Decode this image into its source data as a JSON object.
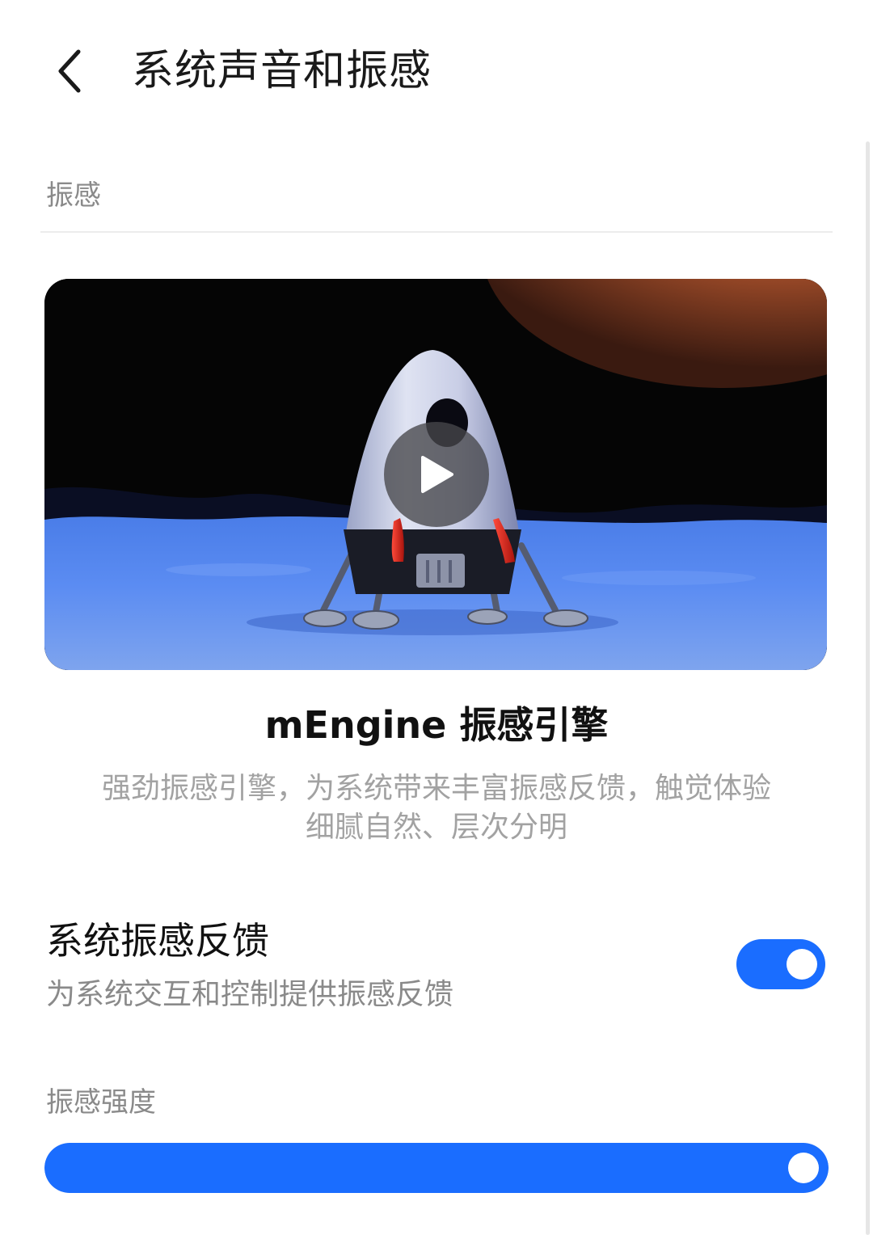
{
  "header": {
    "title": "系统声音和振感"
  },
  "section": {
    "label": "振感"
  },
  "feature": {
    "title": "mEngine 振感引擎",
    "description": "强劲振感引擎，为系统带来丰富振感反馈，触觉体验细腻自然、层次分明"
  },
  "system_haptics": {
    "title": "系统振感反馈",
    "subtitle": "为系统交互和控制提供振感反馈",
    "enabled": true
  },
  "intensity": {
    "label": "振感强度",
    "value": 1.0
  },
  "colors": {
    "accent": "#1a6dff",
    "label_gray": "#8a8a8a",
    "desc_gray": "#a2a2a2"
  },
  "icons": {
    "back": "chevron-left-icon",
    "play": "play-icon"
  }
}
